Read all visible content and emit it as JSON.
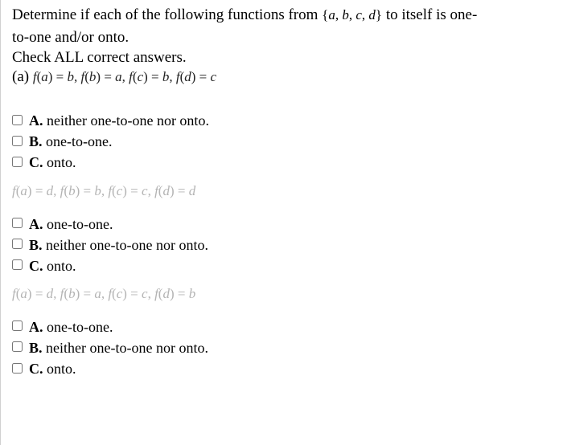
{
  "intro_line1": "Determine if each of the following functions from ",
  "intro_set": "{a, b, c, d}",
  "intro_line1b": " to itself is one-",
  "intro_line2": "to-one and/or onto.",
  "check_all": "Check ALL correct answers.",
  "part_a_label": "(a) ",
  "part_a_formula": "f(a) = b, f(b) = a, f(c) = b, f(d) = c",
  "q1": {
    "A": "neither one-to-one nor onto.",
    "B": "one-to-one.",
    "C": "onto."
  },
  "part_b_formula": "f(a) = d, f(b) = b, f(c) = c, f(d) = d",
  "q2": {
    "A": "one-to-one.",
    "B": "neither one-to-one nor onto.",
    "C": "onto."
  },
  "part_c_formula": "f(a) = d, f(b) = a, f(c) = c, f(d) = b",
  "q3": {
    "A": "one-to-one.",
    "B": "neither one-to-one nor onto.",
    "C": "onto."
  },
  "labels": {
    "A": "A.",
    "B": "B.",
    "C": "C."
  }
}
